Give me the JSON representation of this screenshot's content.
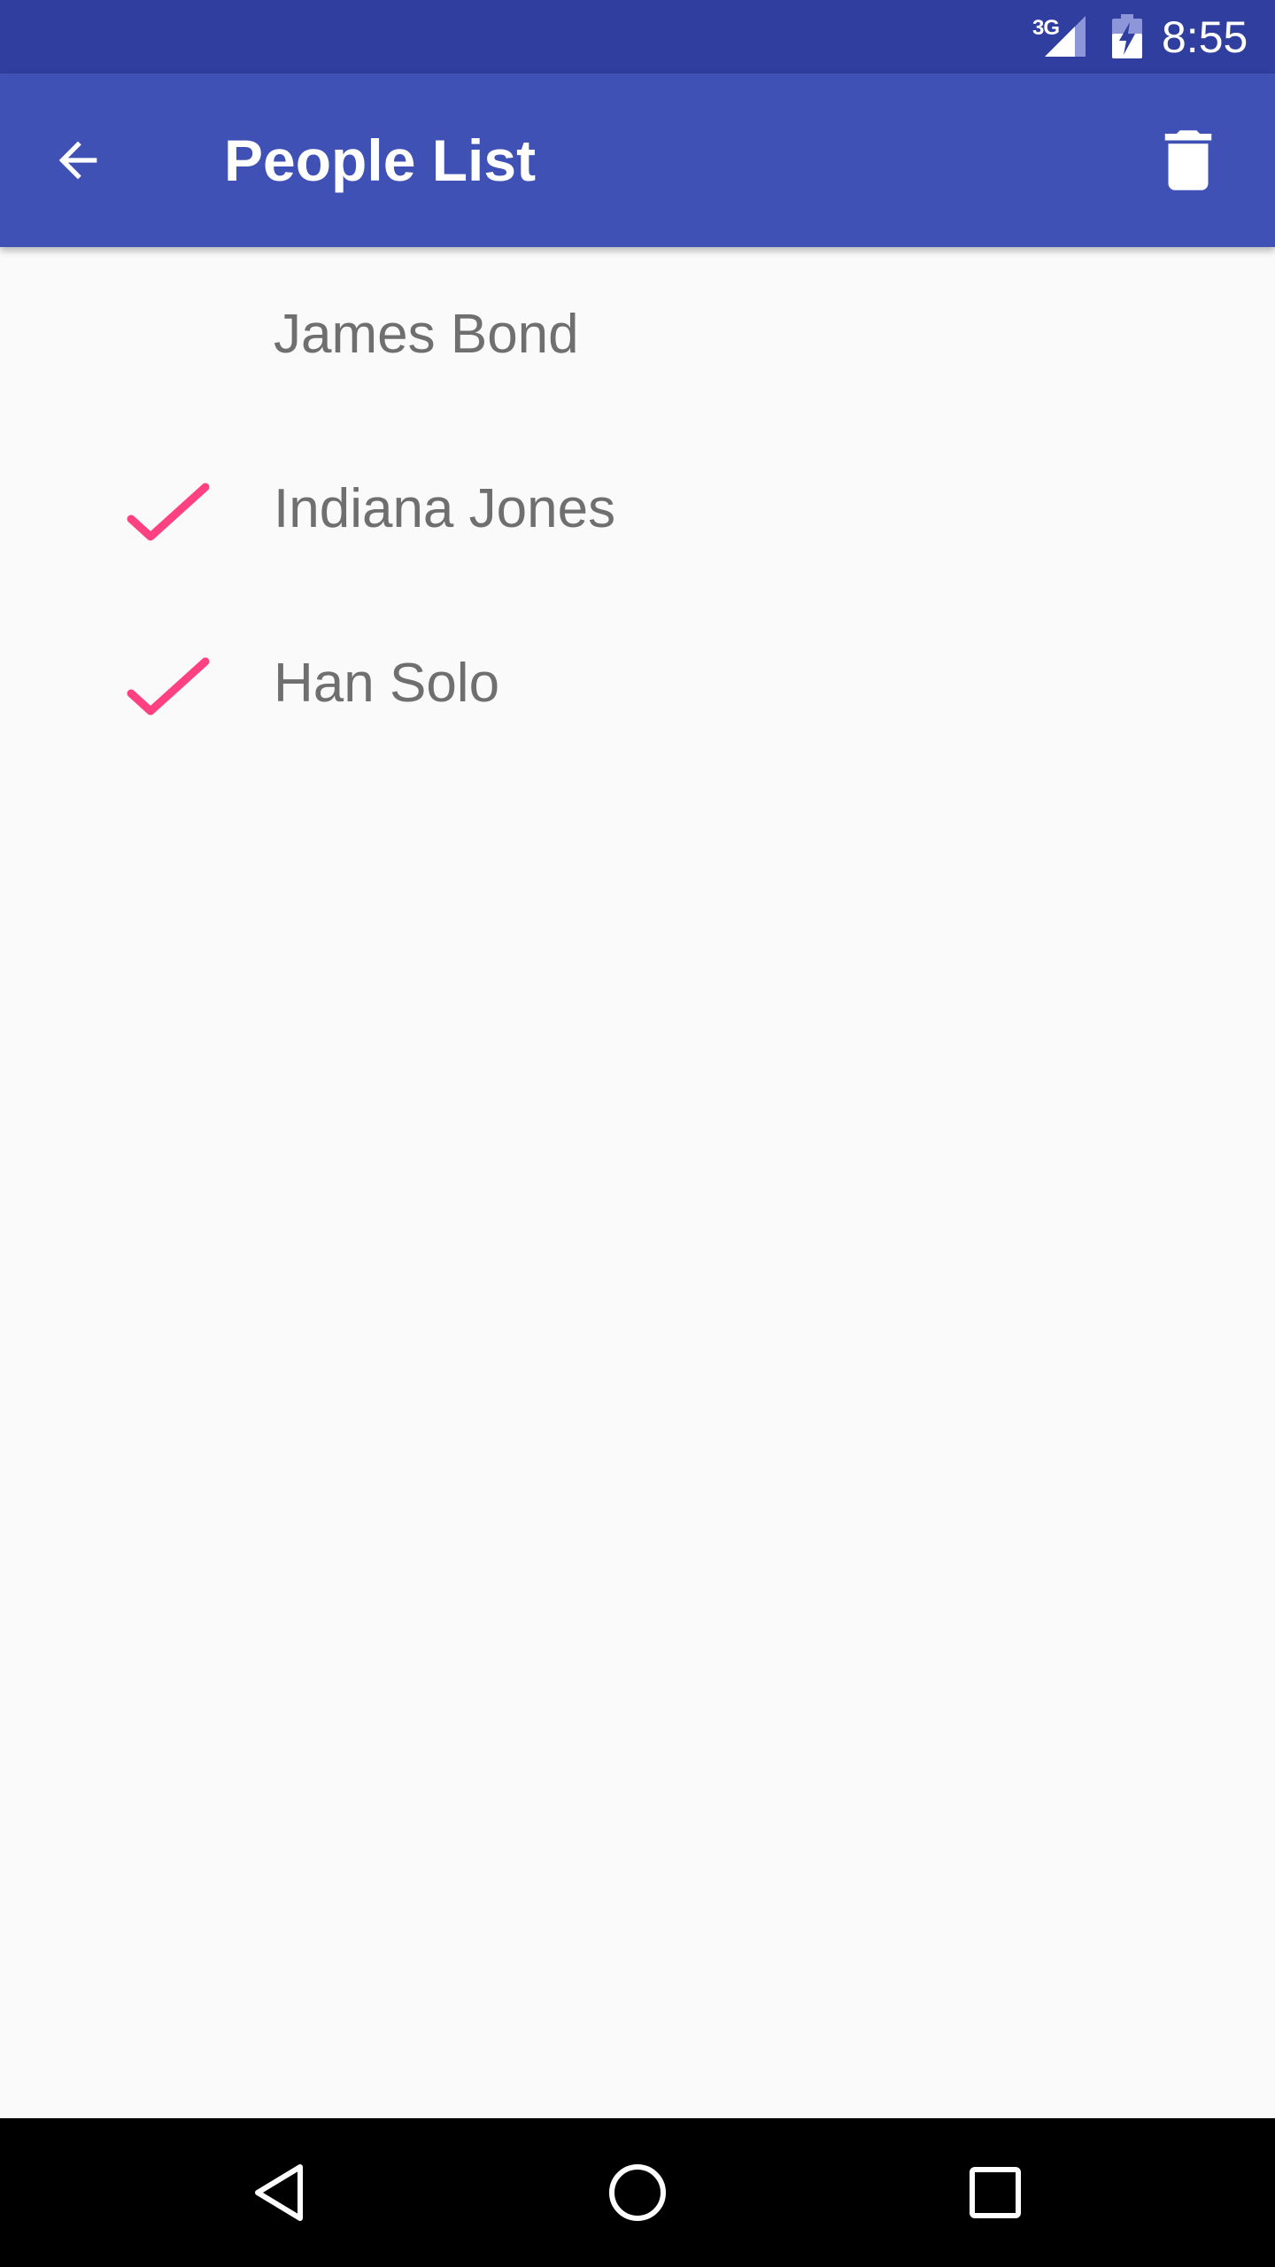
{
  "status_bar": {
    "network": "3G",
    "time": "8:55",
    "icons": [
      "signal-icon",
      "battery-charging-icon"
    ]
  },
  "app_bar": {
    "title": "People List",
    "back_icon": "arrow-back-icon",
    "delete_icon": "trash-icon"
  },
  "people": [
    {
      "name": "James Bond",
      "checked": false
    },
    {
      "name": "Indiana Jones",
      "checked": true
    },
    {
      "name": "Han Solo",
      "checked": true
    }
  ],
  "nav_bar": {
    "icons": [
      "nav-back-icon",
      "nav-home-icon",
      "nav-recents-icon"
    ]
  },
  "colors": {
    "status_bar": "#303f9f",
    "app_bar": "#3f51b5",
    "check_accent": "#ff4081",
    "text_secondary": "#6f6f6f",
    "background": "#fafafa"
  }
}
